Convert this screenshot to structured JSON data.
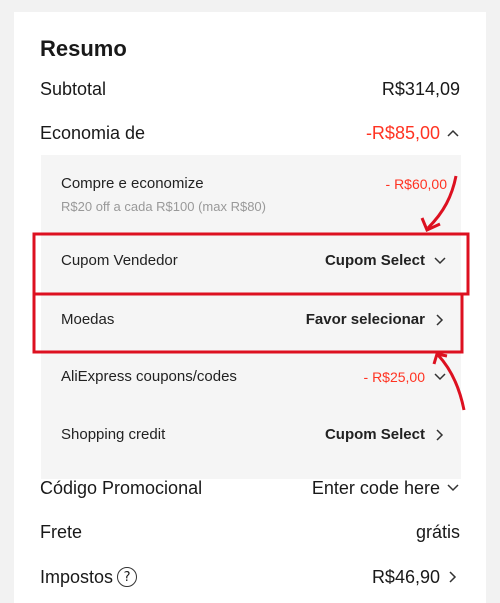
{
  "summary": {
    "title": "Resumo",
    "subtotal_label": "Subtotal",
    "subtotal_value": "R$314,09",
    "savings_label": "Economia de",
    "savings_value": "-R$85,00",
    "savings_items": [
      {
        "label": "Compre e economize",
        "sublabel": "R$20 off a cada R$100 (max R$80)",
        "value": "- R$60,00"
      },
      {
        "label": "Cupom Vendedor",
        "value": "Cupom Select"
      },
      {
        "label": "Moedas",
        "value": "Favor selecionar"
      },
      {
        "label": "AliExpress coupons/codes",
        "value": "- R$25,00"
      },
      {
        "label": "Shopping credit",
        "value": "Cupom Select"
      }
    ],
    "promo_label": "Código Promocional",
    "promo_value": "Enter code here",
    "shipping_label": "Frete",
    "shipping_value": "grátis",
    "taxes_label": "Impostos",
    "taxes_value": "R$46,90"
  },
  "colors": {
    "accent": "#ff3322",
    "annotation": "#dd1020"
  },
  "icons": {
    "collapse": "chevron-up-icon",
    "expand": "chevron-down-icon",
    "next": "chevron-right-icon",
    "help": "question-circle-icon"
  }
}
